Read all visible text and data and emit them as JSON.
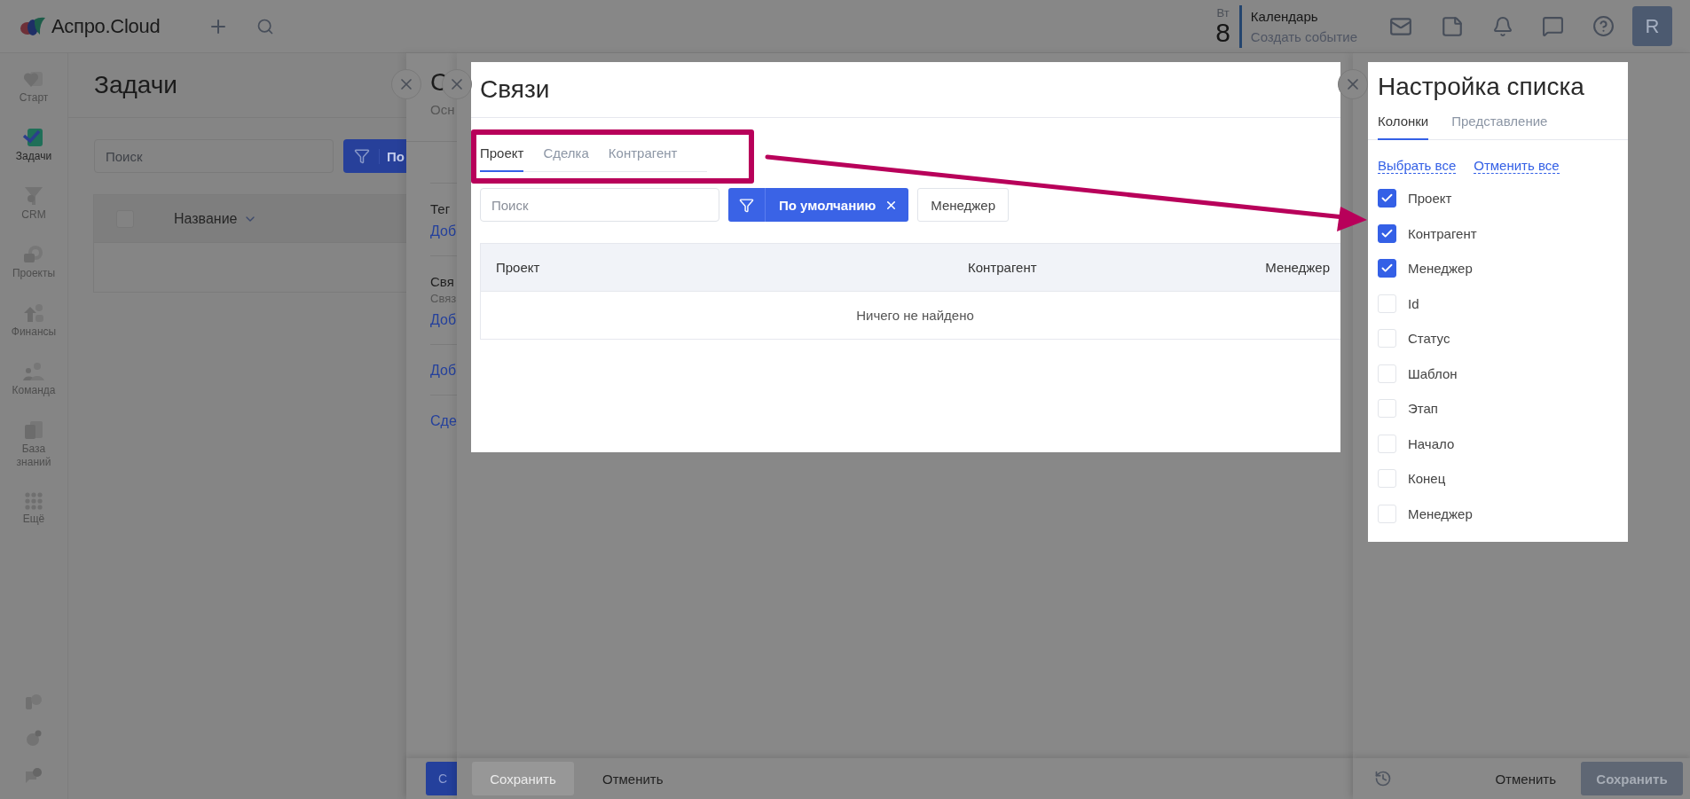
{
  "topbar": {
    "logo": "Аспро.Cloud",
    "calendar": {
      "weekday": "Вт",
      "day": "8",
      "title": "Календарь",
      "action": "Создать событие"
    },
    "avatar": "R"
  },
  "sidebar": {
    "items": [
      {
        "label": "Старт",
        "selected": false
      },
      {
        "label": "Задачи",
        "selected": true
      },
      {
        "label": "CRM",
        "selected": false
      },
      {
        "label": "Проекты",
        "selected": false
      },
      {
        "label": "Финансы",
        "selected": false
      },
      {
        "label": "Команда",
        "selected": false
      },
      {
        "label": "База знаний",
        "selected": false
      },
      {
        "label": "Ещё",
        "selected": false
      }
    ]
  },
  "tasks": {
    "title": "Задачи",
    "search": {
      "placeholder": "Поиск"
    },
    "filter_label": "По",
    "table": {
      "select_all_checked": false,
      "columns": [
        "Название"
      ]
    }
  },
  "card": {
    "title": "С",
    "subtitle": "Осн",
    "sections": [
      {
        "title": "Тег",
        "link": "Доб"
      },
      {
        "title": "Свя",
        "subtitle": "Связ",
        "link": "Доб"
      },
      {
        "link": "Доб"
      },
      {
        "link": "Сде"
      }
    ],
    "save": "С"
  },
  "links_modal": {
    "title": "Связи",
    "tabs": [
      {
        "label": "Проект",
        "selected": true
      },
      {
        "label": "Сделка",
        "selected": false
      },
      {
        "label": "Контрагент",
        "selected": false
      }
    ],
    "search": {
      "placeholder": "Поиск"
    },
    "filter": {
      "label": "По умолчанию"
    },
    "manager_button": "Менеджер",
    "table": {
      "columns": [
        "Проект",
        "Контрагент",
        "Менеджер"
      ],
      "empty": "Ничего не найдено"
    },
    "footer": {
      "save": "Сохранить",
      "cancel": "Отменить"
    }
  },
  "list_settings": {
    "title": "Настройка списка",
    "tabs": [
      {
        "label": "Колонки",
        "selected": true
      },
      {
        "label": "Представление",
        "selected": false
      }
    ],
    "select_all": "Выбрать все",
    "clear_all": "Отменить все",
    "columns": [
      {
        "label": "Проект",
        "checked": true
      },
      {
        "label": "Контрагент",
        "checked": true
      },
      {
        "label": "Менеджер",
        "checked": true
      },
      {
        "label": "Id",
        "checked": false
      },
      {
        "label": "Статус",
        "checked": false
      },
      {
        "label": "Шаблон",
        "checked": false
      },
      {
        "label": "Этап",
        "checked": false
      },
      {
        "label": "Начало",
        "checked": false
      },
      {
        "label": "Конец",
        "checked": false
      },
      {
        "label": "Менеджер",
        "checked": false
      }
    ],
    "footer": {
      "cancel": "Отменить",
      "save": "Сохранить"
    }
  }
}
